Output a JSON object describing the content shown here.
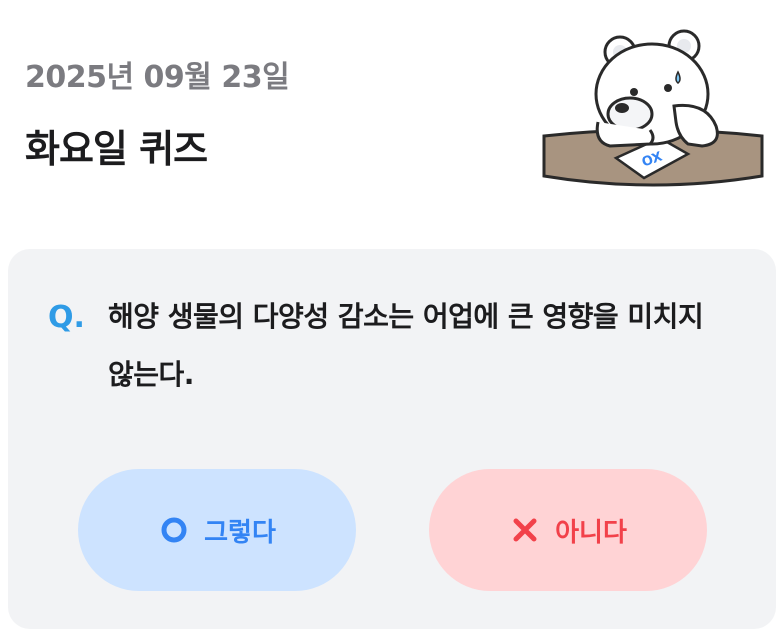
{
  "header": {
    "date": "2025년 09월 23일",
    "title": "화요일 퀴즈"
  },
  "quiz": {
    "q_marker": "Q.",
    "question": "해양 생물의 다양성 감소는 어업에 큰 영향을 미치지 않는다.",
    "answers": {
      "yes": {
        "label": "그렇다",
        "icon": "circle-o-icon",
        "color": "#3384f4",
        "background": "#cde3ff"
      },
      "no": {
        "label": "아니다",
        "icon": "x-cross-icon",
        "color": "#f2414a",
        "background": "#ffd3d5"
      }
    }
  },
  "mascot": {
    "name": "polar-bear-mascot-icon",
    "paper_text": "OX"
  },
  "colors": {
    "accent_blue": "#2f9be6",
    "card_bg": "#f2f3f5",
    "date_gray": "#7b7b80"
  }
}
